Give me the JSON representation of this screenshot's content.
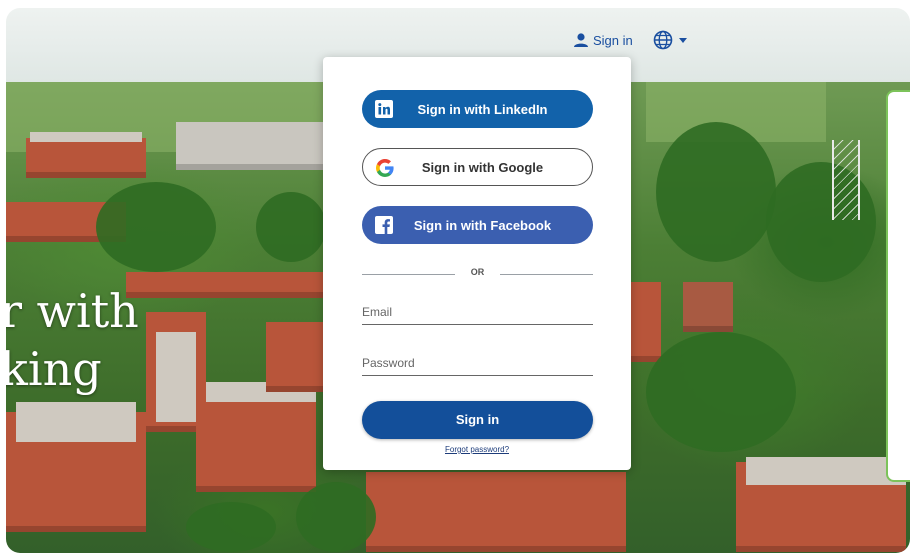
{
  "header": {
    "signin_label": "Sign in",
    "icons": {
      "user": "user-icon",
      "language": "globe-icon",
      "dropdown": "caret-down-icon"
    }
  },
  "hero": {
    "text_line1": "r with",
    "text_line2": "king"
  },
  "card": {
    "linkedin_label": "Sign in with LinkedIn",
    "google_label": "Sign in with Google",
    "facebook_label": "Sign in with Facebook",
    "divider_text": "OR",
    "email_placeholder": "Email",
    "password_placeholder": "Password",
    "submit_label": "Sign in",
    "forgot_label": "Forgot password?"
  },
  "colors": {
    "primary": "#134f9a",
    "linkedin": "#1262aa",
    "facebook": "#3b5fb0",
    "link": "#1a4fa0",
    "panel_border": "#7cc35a"
  }
}
